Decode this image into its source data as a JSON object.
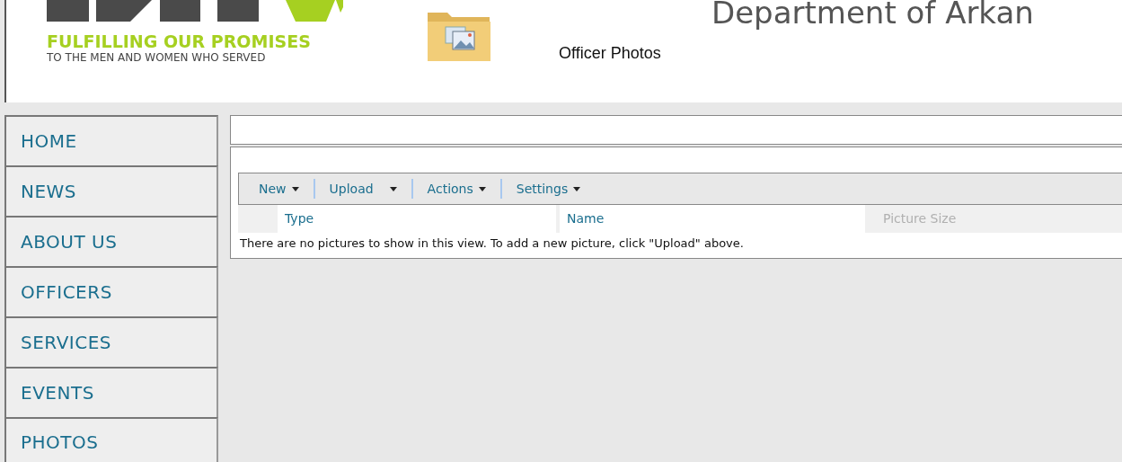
{
  "header": {
    "tagline": "FULFILLING OUR PROMISES",
    "subtagline": "TO THE MEN AND WOMEN WHO SERVED",
    "site_title": "Department of Arkan",
    "page_title": "Officer Photos"
  },
  "nav": [
    {
      "label": "HOME"
    },
    {
      "label": "NEWS"
    },
    {
      "label": "ABOUT US"
    },
    {
      "label": "OFFICERS"
    },
    {
      "label": "SERVICES"
    },
    {
      "label": "EVENTS"
    },
    {
      "label": "PHOTOS"
    }
  ],
  "toolbar": [
    {
      "label": "New"
    },
    {
      "label": "Upload"
    },
    {
      "label": "Actions"
    },
    {
      "label": "Settings"
    }
  ],
  "table": {
    "columns": [
      {
        "label": "Type",
        "disabled": false
      },
      {
        "label": "Name",
        "disabled": false
      },
      {
        "label": "Picture Size",
        "disabled": true
      }
    ],
    "empty_message": "There are no pictures to show in this view. To add a new picture, click \"Upload\" above."
  }
}
